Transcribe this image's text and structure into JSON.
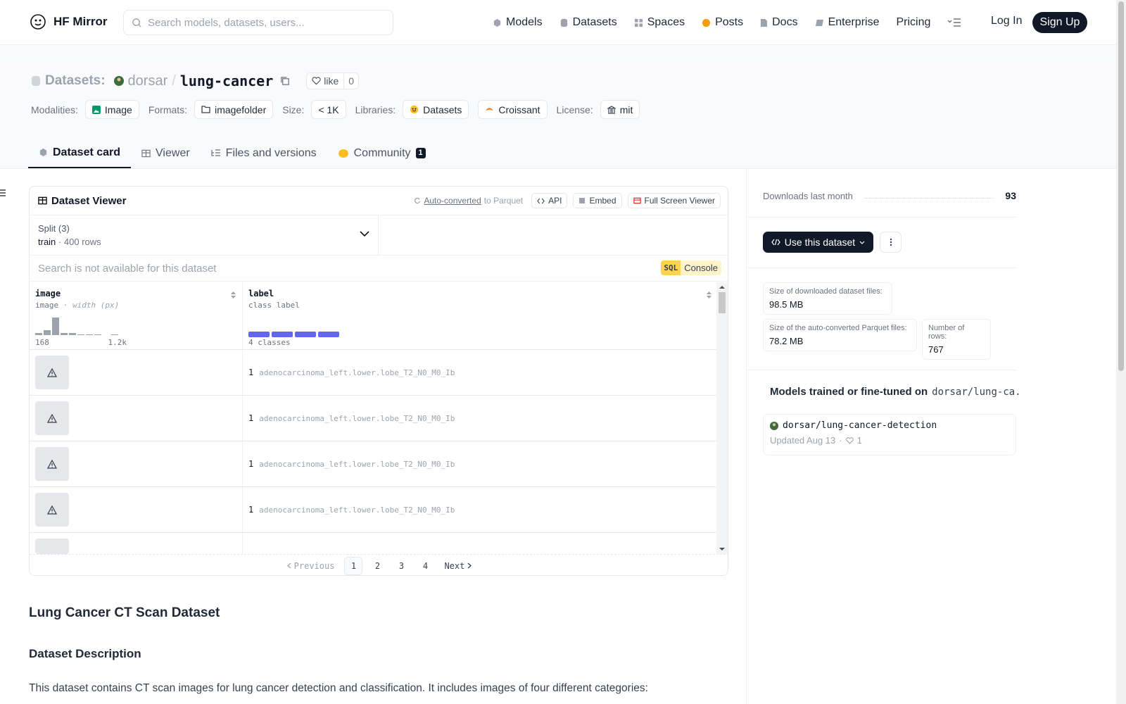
{
  "nav": {
    "brand": "HF Mirror",
    "search_placeholder": "Search models, datasets, users...",
    "items": [
      {
        "label": "Models",
        "icon": "cube-icon",
        "color": "#6b7280"
      },
      {
        "label": "Datasets",
        "icon": "database-icon",
        "color": "#6b7280"
      },
      {
        "label": "Spaces",
        "icon": "grid-icon",
        "color": "#6b7280"
      },
      {
        "label": "Posts",
        "icon": "chat-bubble-icon",
        "color": "#f59e0b"
      },
      {
        "label": "Docs",
        "icon": "document-icon",
        "color": "#6b7280"
      },
      {
        "label": "Enterprise",
        "icon": "building-icon",
        "color": "#6b7280"
      },
      {
        "label": "Pricing",
        "icon": "",
        "color": ""
      }
    ],
    "login": "Log In",
    "signup": "Sign Up"
  },
  "header": {
    "section": "Datasets:",
    "owner": "dorsar",
    "slash": "/",
    "repo": "lung-cancer",
    "like_label": "like",
    "like_count": "0",
    "tags": [
      {
        "key": "Modalities:",
        "values": [
          "Image"
        ]
      },
      {
        "key": "Formats:",
        "values": [
          "imagefolder"
        ]
      },
      {
        "key": "Size:",
        "values": [
          "< 1K"
        ]
      },
      {
        "key": "Libraries:",
        "values": [
          "Datasets",
          "Croissant"
        ]
      },
      {
        "key": "License:",
        "values": [
          "mit"
        ]
      }
    ]
  },
  "tabs": [
    {
      "label": "Dataset card",
      "active": true
    },
    {
      "label": "Viewer",
      "active": false
    },
    {
      "label": "Files and versions",
      "active": false
    },
    {
      "label": "Community",
      "active": false,
      "badge": "1"
    }
  ],
  "viewer": {
    "title": "Dataset Viewer",
    "auto_converted": "Auto-converted",
    "to_parquet": "to Parquet",
    "api": "API",
    "embed": "Embed",
    "fullscreen": "Full Screen Viewer",
    "split_label": "Split (3)",
    "split_name": "train",
    "split_dot": "·",
    "split_rows": "400 rows",
    "search_placeholder": "Search is not available for this dataset",
    "sql": "SQL",
    "console": "Console",
    "columns": [
      {
        "name": "image",
        "type": "image",
        "sub": "· width (px)",
        "range_min": "168",
        "range_max": "1.2k"
      },
      {
        "name": "label",
        "type": "class label",
        "sub": "",
        "classes": "4 classes"
      }
    ],
    "histogram": [
      2,
      5,
      18,
      2,
      2,
      1,
      1,
      1,
      0,
      1
    ],
    "rows": [
      {
        "class_id": "1",
        "class_name": "adenocarcinoma_left.lower.lobe_T2_N0_M0_Ib"
      },
      {
        "class_id": "1",
        "class_name": "adenocarcinoma_left.lower.lobe_T2_N0_M0_Ib"
      },
      {
        "class_id": "1",
        "class_name": "adenocarcinoma_left.lower.lobe_T2_N0_M0_Ib"
      },
      {
        "class_id": "1",
        "class_name": "adenocarcinoma_left.lower.lobe_T2_N0_M0_Ib"
      }
    ],
    "pager": {
      "prev": "Previous",
      "pages": [
        "1",
        "2",
        "3",
        "4"
      ],
      "current": "1",
      "next": "Next"
    }
  },
  "card": {
    "h1": "Lung Cancer CT Scan Dataset",
    "h2": "Dataset Description",
    "p1": "This dataset contains CT scan images for lung cancer detection and classification. It includes images of four different categories:"
  },
  "sidebar": {
    "downloads_label": "Downloads last month",
    "downloads_value": "93",
    "use_button": "Use this dataset",
    "stats": [
      {
        "label": "Size of downloaded dataset files:",
        "value": "98.5 MB"
      },
      {
        "label": "Size of the auto-converted Parquet files:",
        "value": "78.2 MB"
      },
      {
        "label": "Number of rows:",
        "value": "767"
      }
    ],
    "models_title": "Models trained or fine-tuned on",
    "models_repo": "dorsar/lung-ca...",
    "model": {
      "name": "dorsar/lung-cancer-detection",
      "updated": "Updated Aug 13",
      "sep": "·",
      "likes": "1"
    }
  }
}
